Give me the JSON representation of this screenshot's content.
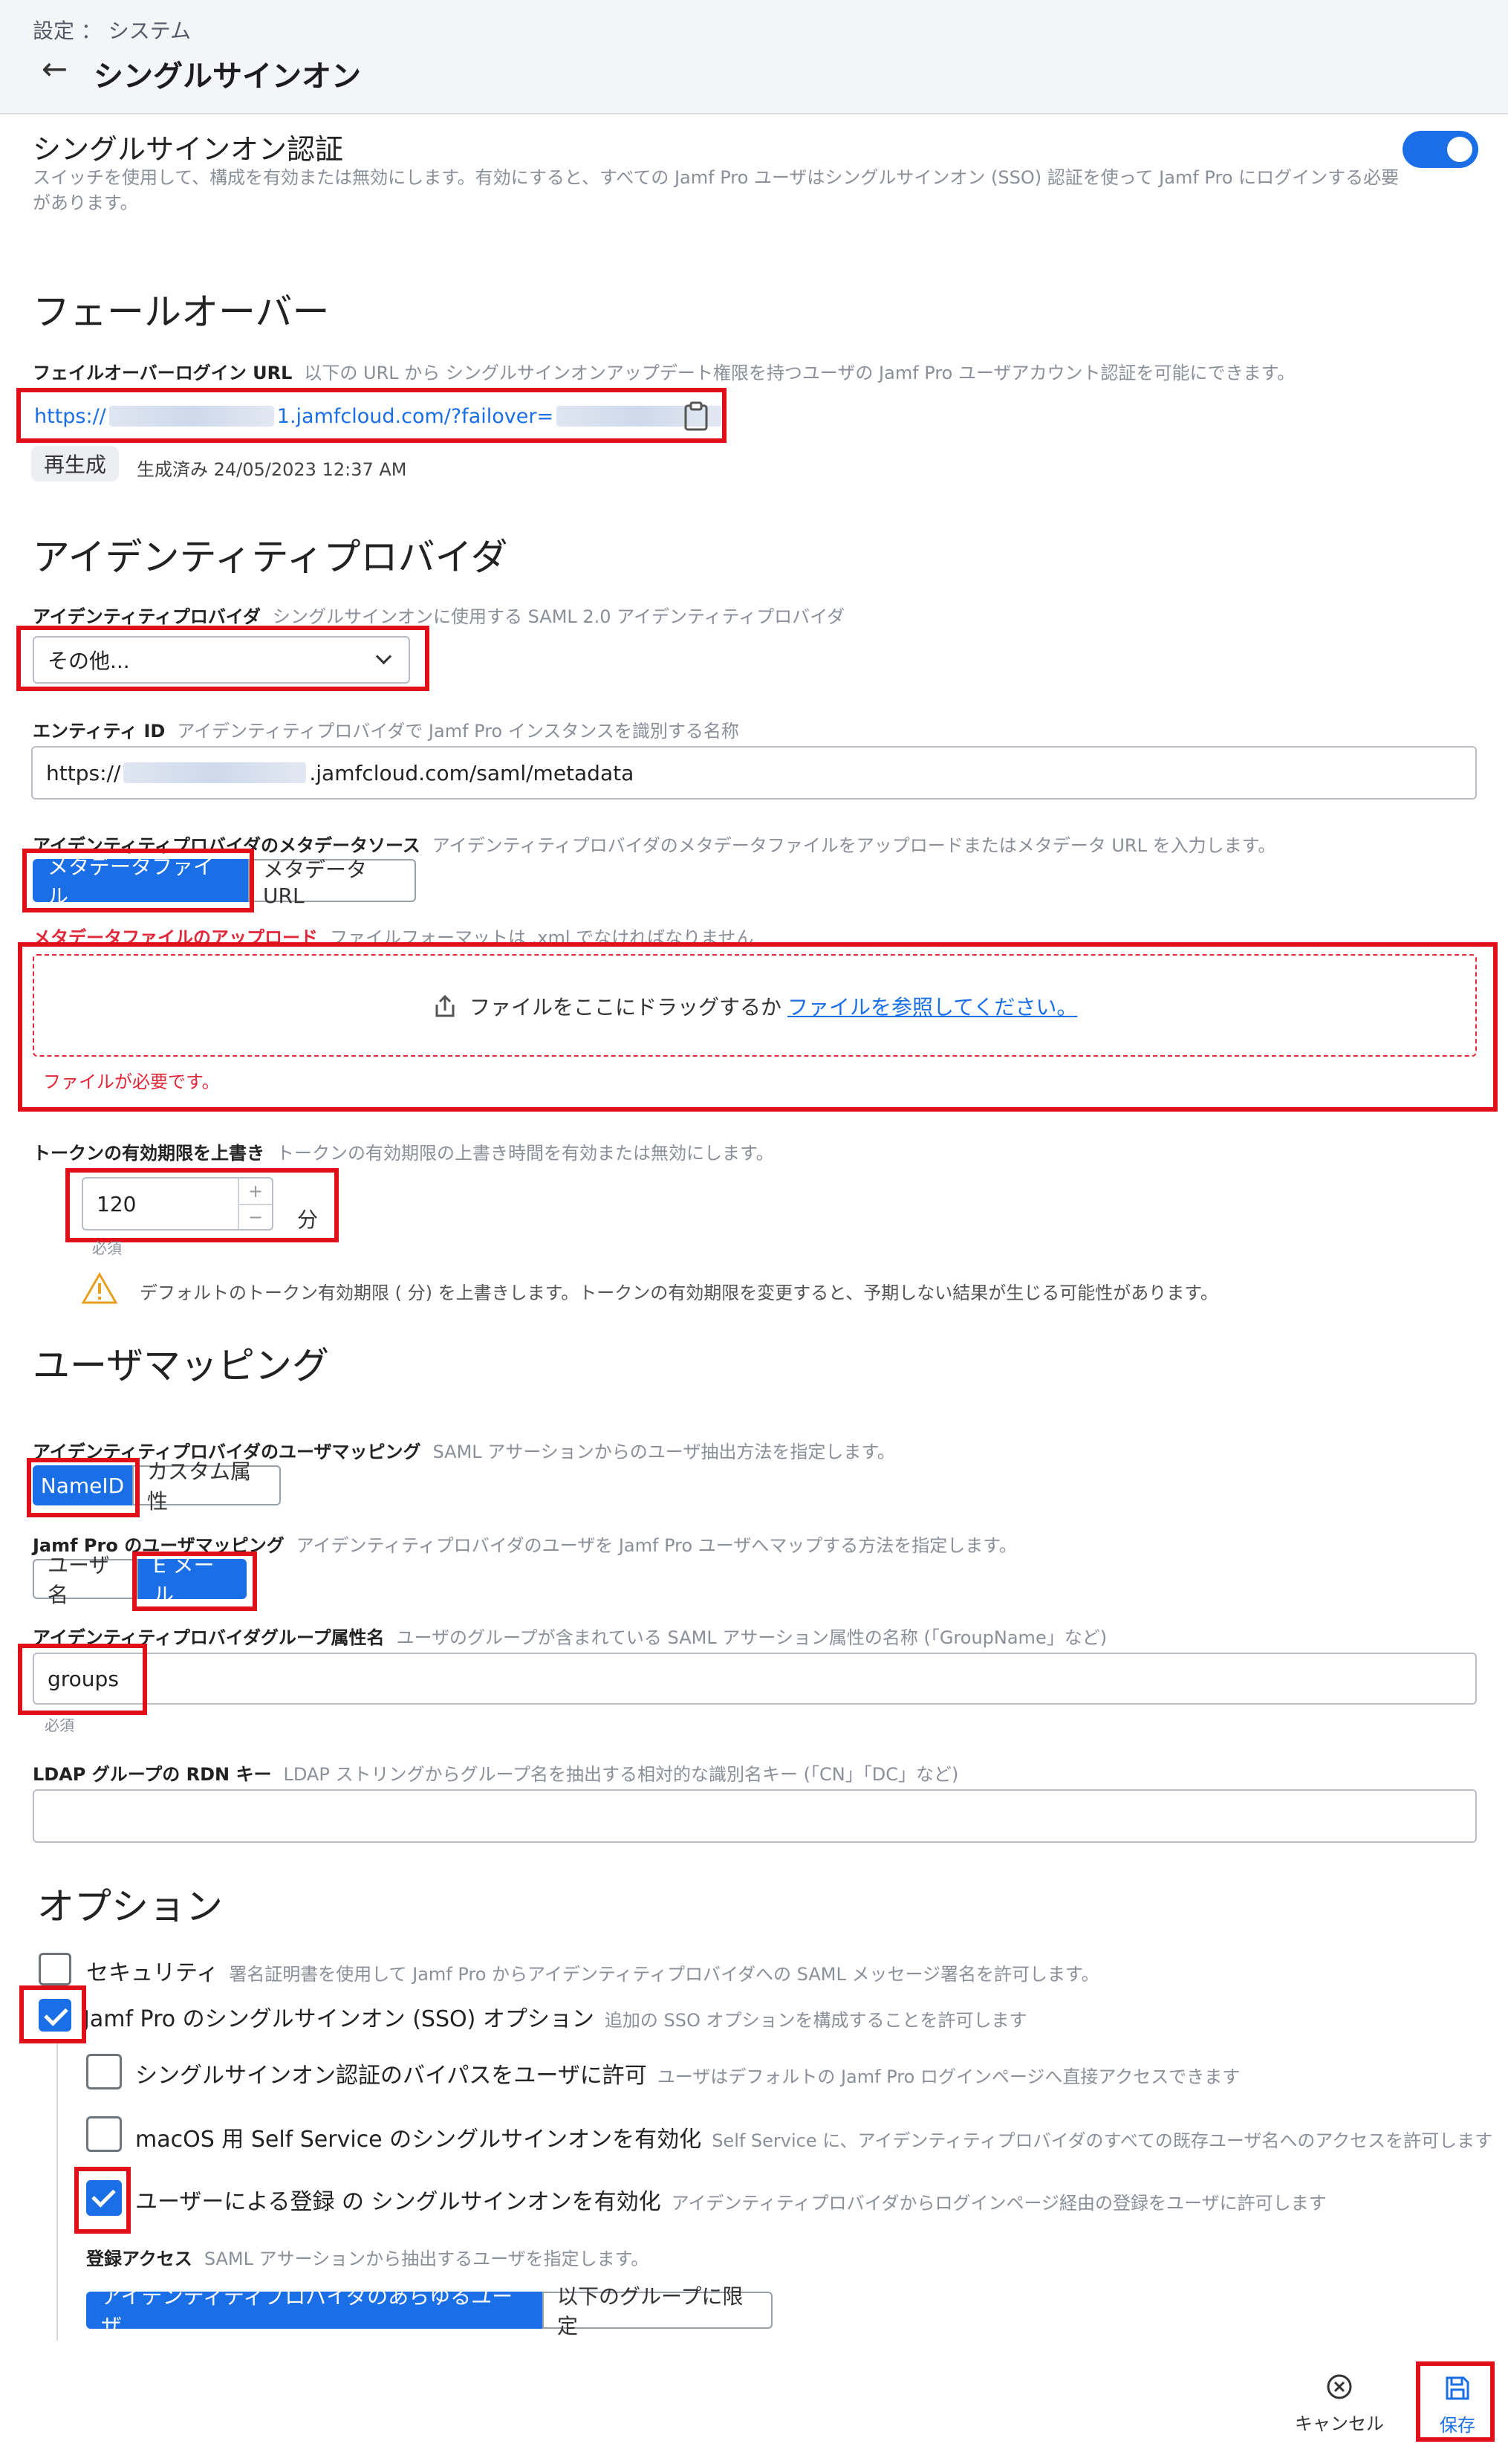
{
  "header": {
    "breadcrumb": "設定 ： システム",
    "back_icon": "←",
    "title": "シングルサインオン"
  },
  "sso": {
    "title": "シングルサインオン認証",
    "description": "スイッチを使用して、構成を有効または無効にします。有効にすると、すべての Jamf Pro ユーザはシングルサインオン (SSO) 認証を使って Jamf Pro にログインする必要があります。",
    "enabled": true
  },
  "failover": {
    "section_title": "フェールオーバー",
    "label": "フェイルオーバーログイン URL",
    "help": "以下の URL から シングルサインオンアップデート権限を持つユーザの Jamf Pro ユーザアカウント認証を可能にできます。",
    "url_prefix": "https://",
    "url_middle": "1.jamfcloud.com/?failover=",
    "regenerate_label": "再生成",
    "generated_text": "生成済み 24/05/2023 12:37 AM"
  },
  "idp": {
    "section_title": "アイデンティティプロバイダ",
    "provider_label": "アイデンティティプロバイダ",
    "provider_help": "シングルサインオンに使用する SAML 2.0 アイデンティティプロバイダ",
    "provider_value": "その他...",
    "entity_label": "エンティティ ID",
    "entity_help": "アイデンティティプロバイダで Jamf Pro インスタンスを識別する名称",
    "entity_prefix": "https://",
    "entity_suffix": ".jamfcloud.com/saml/metadata",
    "metadata_source_label": "アイデンティティプロバイダのメタデータソース",
    "metadata_source_help": "アイデンティティプロバイダのメタデータファイルをアップロードまたはメタデータ URL を入力します。",
    "metadata_options": [
      "メタデータファイル",
      "メタデータ URL"
    ],
    "upload_label": "メタデータファイルのアップロード",
    "upload_help": "ファイルフォーマットは .xml でなければなりません",
    "drop_text": "ファイルをここにドラッグするか",
    "browse_link": "ファイルを参照してください。",
    "file_error": "ファイルが必要です。",
    "token_label": "トークンの有効期限を上書き",
    "token_help": "トークンの有効期限の上書き時間を有効または無効にします。",
    "token_value": "120",
    "token_unit": "分",
    "required_text": "必須",
    "token_warning": "デフォルトのトークン有効期限 ( 分) を上書きします。トークンの有効期限を変更すると、予期しない結果が生じる可能性があります。"
  },
  "mapping": {
    "section_title": "ユーザマッピング",
    "idp_mapping_label": "アイデンティティプロバイダのユーザマッピング",
    "idp_mapping_help": "SAML アサーションからのユーザ抽出方法を指定します。",
    "idp_mapping_options": [
      "NameID",
      "カスタム属性"
    ],
    "jamf_mapping_label": "Jamf Pro のユーザマッピング",
    "jamf_mapping_help": "アイデンティティプロバイダのユーザを Jamf Pro ユーザへマップする方法を指定します。",
    "jamf_mapping_options": [
      "ユーザ名",
      "E メール"
    ],
    "group_attr_label": "アイデンティティプロバイダグループ属性名",
    "group_attr_help": "ユーザのグループが含まれている SAML アサーション属性の名称 (「GroupName」など)",
    "group_attr_value": "groups",
    "required_text": "必須",
    "rdn_label": "LDAP グループの RDN キー",
    "rdn_help": "LDAP ストリングからグループ名を抽出する相対的な識別名キー (「CN」「DC」など)",
    "rdn_value": ""
  },
  "options": {
    "section_title": "オプション",
    "security_label": "セキュリティ",
    "security_help": "署名証明書を使用して Jamf Pro からアイデンティティプロバイダへの SAML メッセージ署名を許可します。",
    "security_checked": false,
    "sso_options_label": "Jamf Pro のシングルサインオン (SSO) オプション",
    "sso_options_help": "追加の SSO オプションを構成することを許可します",
    "sso_options_checked": true,
    "bypass_label": "シングルサインオン認証のバイパスをユーザに許可",
    "bypass_help": "ユーザはデフォルトの Jamf Pro ログインページへ直接アクセスできます",
    "bypass_checked": false,
    "macos_label": "macOS 用 Self Service のシングルサインオンを有効化",
    "macos_help": "Self Service に、アイデンティティプロバイダのすべての既存ユーザ名へのアクセスを許可します",
    "macos_checked": false,
    "enroll_label": "ユーザーによる登録 の シングルサインオンを有効化",
    "enroll_help": "アイデンティティプロバイダからログインページ経由の登録をユーザに許可します",
    "enroll_checked": true,
    "enroll_access_label": "登録アクセス",
    "enroll_access_help": "SAML アサーションから抽出するユーザを指定します。",
    "enroll_access_options": [
      "アイデンティティプロバイダのあらゆるユーザ",
      "以下のグループに限定"
    ]
  },
  "footer": {
    "cancel_label": "キャンセル",
    "save_label": "保存",
    "cancel_icon": "cancel-icon",
    "save_icon": "save-icon"
  },
  "colors": {
    "accent": "#1a6fe6",
    "highlight": "#e0101a",
    "error": "#e0283a"
  }
}
